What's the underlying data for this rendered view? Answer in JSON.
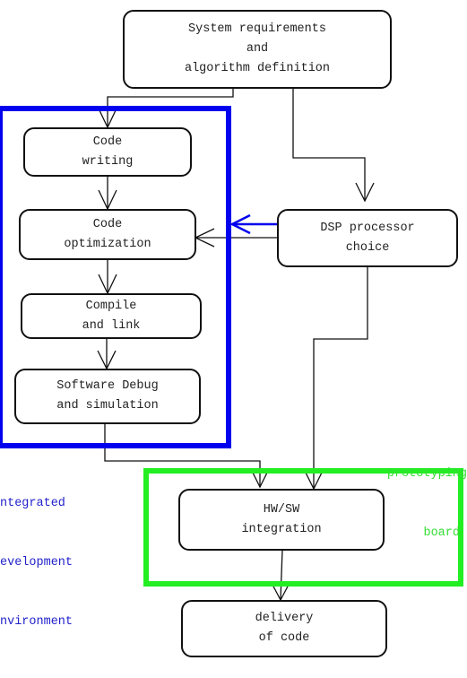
{
  "colors": {
    "ide": "#0000ee",
    "board": "#22ee22",
    "ide_text": "#2222cc",
    "board_text": "#33dd33",
    "line": "#111111"
  },
  "nodes": {
    "system_requirements": {
      "lines": [
        "System requirements",
        "and",
        "algorithm definition"
      ]
    },
    "code_writing": {
      "lines": [
        "Code",
        "writing"
      ]
    },
    "code_optimization": {
      "lines": [
        "Code",
        "optimization"
      ]
    },
    "compile_link": {
      "lines": [
        "Compile",
        "and link"
      ]
    },
    "software_debug": {
      "lines": [
        "Software Debug",
        "and simulation"
      ]
    },
    "dsp_choice": {
      "lines": [
        "DSP processor",
        "choice"
      ]
    },
    "hw_sw_integration": {
      "lines": [
        "HW/SW",
        "integration"
      ]
    },
    "delivery": {
      "lines": [
        "delivery",
        "of code"
      ]
    }
  },
  "groups": {
    "ide": {
      "lines": [
        "ntegrated",
        "evelopment",
        "nvironment"
      ]
    },
    "board": {
      "lines": [
        "prototyping",
        "board"
      ]
    }
  },
  "edges": [
    {
      "from": "system_requirements",
      "to": "code_writing"
    },
    {
      "from": "system_requirements",
      "to": "dsp_choice"
    },
    {
      "from": "code_writing",
      "to": "code_optimization"
    },
    {
      "from": "code_optimization",
      "to": "compile_link"
    },
    {
      "from": "compile_link",
      "to": "software_debug"
    },
    {
      "from": "dsp_choice",
      "to": "code_optimization"
    },
    {
      "from": "dsp_choice",
      "to": "ide",
      "style": "blue"
    },
    {
      "from": "software_debug",
      "to": "hw_sw_integration"
    },
    {
      "from": "dsp_choice",
      "to": "hw_sw_integration"
    },
    {
      "from": "hw_sw_integration",
      "to": "delivery"
    }
  ]
}
